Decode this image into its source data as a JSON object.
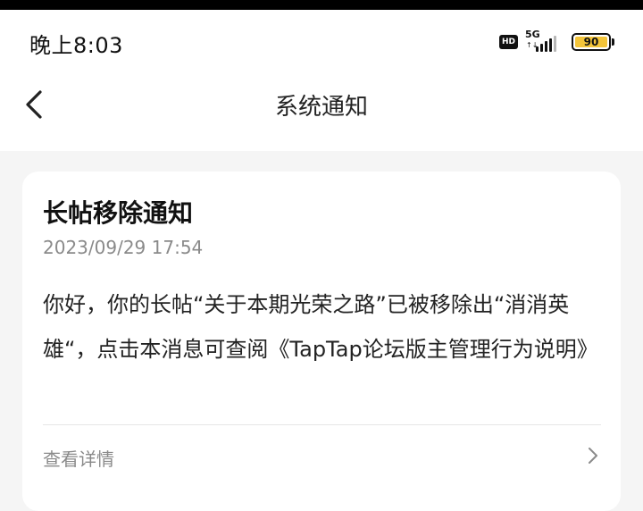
{
  "status_bar": {
    "time": "晚上8:03",
    "hd_badge": "HD",
    "network_label": "5G",
    "network_arrows": "↑↓",
    "battery_percent": "90",
    "battery_color": "#f4c53a",
    "signal_level": 4
  },
  "header": {
    "back_icon": "chevron-left-icon",
    "title": "系统通知"
  },
  "notification": {
    "title": "长帖移除通知",
    "timestamp": "2023/09/29 17:54",
    "body": "你好，你的长帖“关于本期光荣之路”已被移除出“消消英雄“，点击本消息可查阅《TapTap论坛版主管理行为说明》",
    "details_label": "查看详情",
    "details_icon": "chevron-right-icon"
  }
}
